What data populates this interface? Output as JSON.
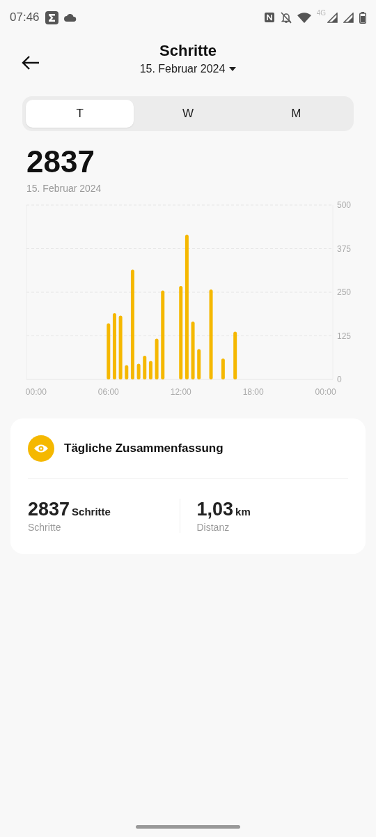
{
  "status_bar": {
    "time": "07:46",
    "network": "4G"
  },
  "header": {
    "title": "Schritte",
    "date": "15. Februar 2024"
  },
  "tabs": [
    {
      "label": "T",
      "selected": true
    },
    {
      "label": "W",
      "selected": false
    },
    {
      "label": "M",
      "selected": false
    }
  ],
  "total": {
    "value": "2837",
    "date": "15. Februar 2024"
  },
  "chart_data": {
    "type": "bar",
    "x": [
      6,
      6.5,
      7,
      7.5,
      8,
      8.5,
      9,
      9.5,
      10,
      10.5,
      12,
      12.5,
      13,
      13.5,
      14.5,
      15.5,
      16.5
    ],
    "series": [
      {
        "color": "#f5b800",
        "values": [
          161,
          190,
          183,
          41,
          315,
          45,
          68,
          53,
          117,
          255,
          268,
          415,
          166,
          87,
          258,
          60,
          137
        ]
      }
    ],
    "xlim": [
      -0.8,
      24.6
    ],
    "grid": true,
    "ylim": [
      0,
      500
    ],
    "xticks": [
      {
        "value": 0,
        "label": "00:00"
      },
      {
        "value": 6,
        "label": "06:00"
      },
      {
        "value": 12,
        "label": "12:00"
      },
      {
        "value": 18,
        "label": "18:00"
      },
      {
        "value": 24,
        "label": "00:00"
      }
    ],
    "yticks": [
      0,
      125,
      250,
      375,
      500
    ]
  },
  "summary": {
    "title": "Tägliche Zusammenfassung",
    "stats": [
      {
        "value": "2837",
        "unit": "Schritte",
        "label": "Schritte"
      },
      {
        "value": "1,03",
        "unit": "km",
        "label": "Distanz"
      }
    ]
  }
}
